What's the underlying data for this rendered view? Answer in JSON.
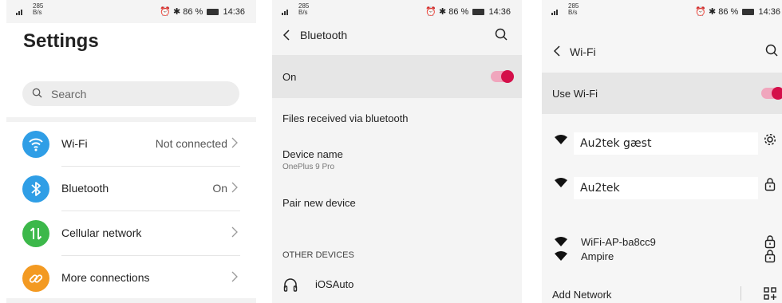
{
  "status_bar": {
    "signal": "4G",
    "speed_top": "285",
    "speed_bottom": "B/s",
    "right": "86 %",
    "time": "14:36"
  },
  "settings": {
    "title": "Settings",
    "search_placeholder": "Search",
    "items": [
      {
        "label": "Wi-Fi",
        "value": "Not connected",
        "icon": "wifi-icon",
        "color": "#2f9ee6"
      },
      {
        "label": "Bluetooth",
        "value": "On",
        "icon": "bluetooth-icon",
        "color": "#2f9ee6"
      },
      {
        "label": "Cellular network",
        "value": "",
        "icon": "cellular-data-icon",
        "color": "#3cb84a"
      },
      {
        "label": "More connections",
        "value": "",
        "icon": "link-icon",
        "color": "#f39a22"
      }
    ]
  },
  "bluetooth": {
    "title": "Bluetooth",
    "on_label": "On",
    "on_state": true,
    "files_label": "Files received via bluetooth",
    "device_name_label": "Device name",
    "device_name_value": "OnePlus 9 Pro",
    "pair_label": "Pair new device",
    "other_devices_header": "OTHER DEVICES",
    "devices": [
      {
        "name": "iOSAuto",
        "icon": "headphones-icon"
      }
    ]
  },
  "wifi": {
    "title": "Wi-Fi",
    "use_wifi_label": "Use Wi-Fi",
    "use_wifi_state": true,
    "networks": [
      {
        "name": "Au2tek gæst",
        "trail_icon": "gear-icon"
      },
      {
        "name": "Au2tek",
        "trail_icon": "lock-icon"
      },
      {
        "name": "WiFi-AP-ba8cc9",
        "trail_icon": "lock-icon"
      },
      {
        "name": "Ampire",
        "trail_icon": "lock-icon"
      }
    ],
    "add_network_label": "Add Network",
    "add_network_icon": "qr-code-icon"
  },
  "colors": {
    "accent": "#d4104a",
    "toggle_track": "#f0a6bd",
    "selected_row": "#e6e6e6"
  }
}
